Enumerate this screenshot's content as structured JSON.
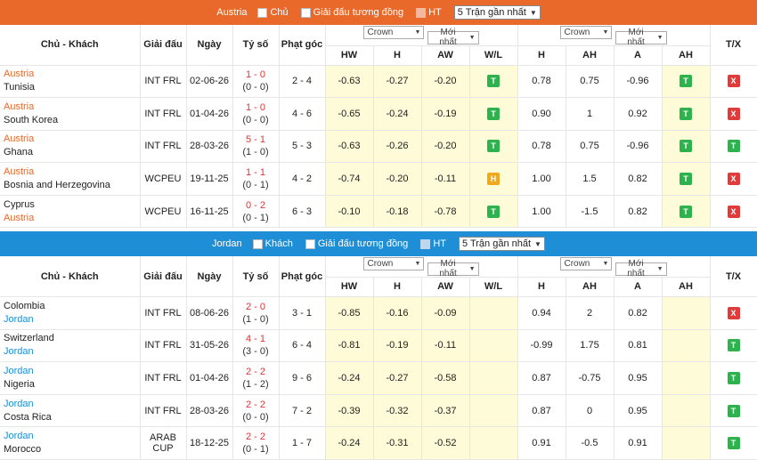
{
  "home_section": {
    "filter": {
      "team": "Austria",
      "home_label": "Chủ",
      "same_league_label": "Giải đấu tương đồng",
      "ht_label": "HT",
      "recent_select": "5 Trận gần nhất"
    },
    "header": {
      "teams": "Chủ - Khách",
      "league": "Giải đấu",
      "date": "Ngày",
      "score": "Tỷ số",
      "corners": "Phạt góc",
      "odds1_company": "Crown",
      "odds1_time": "Mới nhất",
      "odds2_company": "Crown",
      "odds2_time": "Mới nhất",
      "tx": "T/X",
      "hw": "HW",
      "h": "H",
      "aw": "AW",
      "wl": "W/L",
      "h2": "H",
      "ah": "AH",
      "a": "A",
      "ah2": "AH"
    },
    "rows": [
      {
        "home": "Austria",
        "away": "Tunisia",
        "home_color": "orange",
        "away_color": "dark",
        "league": "INT FRL",
        "date": "02-06-26",
        "score": "1 - 0",
        "ht": "(0 - 0)",
        "corners": "2 - 4",
        "hw": "-0.63",
        "h": "-0.27",
        "aw": "-0.20",
        "wl": "T",
        "h2": "0.78",
        "ah": "0.75",
        "a": "-0.96",
        "ah_res": "T",
        "tx": "X"
      },
      {
        "home": "Austria",
        "away": "South Korea",
        "home_color": "orange",
        "away_color": "dark",
        "league": "INT FRL",
        "date": "01-04-26",
        "score": "1 - 0",
        "ht": "(0 - 0)",
        "corners": "4 - 6",
        "hw": "-0.65",
        "h": "-0.24",
        "aw": "-0.19",
        "wl": "T",
        "h2": "0.90",
        "ah": "1",
        "a": "0.92",
        "ah_res": "T",
        "tx": "X"
      },
      {
        "home": "Austria",
        "away": "Ghana",
        "home_color": "orange",
        "away_color": "dark",
        "league": "INT FRL",
        "date": "28-03-26",
        "score": "5 - 1",
        "ht": "(1 - 0)",
        "corners": "5 - 3",
        "hw": "-0.63",
        "h": "-0.26",
        "aw": "-0.20",
        "wl": "T",
        "h2": "0.78",
        "ah": "0.75",
        "a": "-0.96",
        "ah_res": "T",
        "tx": "T"
      },
      {
        "home": "Austria",
        "away": "Bosnia and Herzegovina",
        "home_color": "orange",
        "away_color": "dark",
        "league": "WCPEU",
        "date": "19-11-25",
        "score": "1 - 1",
        "ht": "(0 - 1)",
        "corners": "4 - 2",
        "hw": "-0.74",
        "h": "-0.20",
        "aw": "-0.11",
        "wl": "H",
        "h2": "1.00",
        "ah": "1.5",
        "a": "0.82",
        "ah_res": "T",
        "tx": "X"
      },
      {
        "home": "Cyprus",
        "away": "Austria",
        "home_color": "dark",
        "away_color": "orange",
        "league": "WCPEU",
        "date": "16-11-25",
        "score": "0 - 2",
        "ht": "(0 - 1)",
        "corners": "6 - 3",
        "hw": "-0.10",
        "h": "-0.18",
        "aw": "-0.78",
        "wl": "T",
        "h2": "1.00",
        "ah": "-1.5",
        "a": "0.82",
        "ah_res": "T",
        "tx": "X"
      }
    ]
  },
  "away_section": {
    "filter": {
      "team": "Jordan",
      "away_label": "Khách",
      "same_league_label": "Giải đấu tương đồng",
      "ht_label": "HT",
      "recent_select": "5 Trận gần nhất"
    },
    "header": {
      "teams": "Chủ - Khách",
      "league": "Giải đấu",
      "date": "Ngày",
      "score": "Tỷ số",
      "corners": "Phạt góc",
      "odds1_company": "Crown",
      "odds1_time": "Mới nhất",
      "odds2_company": "Crown",
      "odds2_time": "Mới nhất",
      "tx": "T/X",
      "hw": "HW",
      "h": "H",
      "aw": "AW",
      "wl": "W/L",
      "h2": "H",
      "ah": "AH",
      "a": "A",
      "ah2": "AH"
    },
    "rows": [
      {
        "home": "Colombia",
        "away": "Jordan",
        "home_color": "dark",
        "away_color": "blue",
        "league": "INT FRL",
        "date": "08-06-26",
        "score": "2 - 0",
        "ht": "(1 - 0)",
        "corners": "3 - 1",
        "hw": "-0.85",
        "h": "-0.16",
        "aw": "-0.09",
        "wl": "",
        "h2": "0.94",
        "ah": "2",
        "a": "0.82",
        "ah_res": "",
        "tx": "X"
      },
      {
        "home": "Switzerland",
        "away": "Jordan",
        "home_color": "dark",
        "away_color": "blue",
        "league": "INT FRL",
        "date": "31-05-26",
        "score": "4 - 1",
        "ht": "(3 - 0)",
        "corners": "6 - 4",
        "hw": "-0.81",
        "h": "-0.19",
        "aw": "-0.11",
        "wl": "",
        "h2": "-0.99",
        "ah": "1.75",
        "a": "0.81",
        "ah_res": "",
        "tx": "T"
      },
      {
        "home": "Jordan",
        "away": "Nigeria",
        "home_color": "blue",
        "away_color": "dark",
        "league": "INT FRL",
        "date": "01-04-26",
        "score": "2 - 2",
        "ht": "(1 - 2)",
        "corners": "9 - 6",
        "hw": "-0.24",
        "h": "-0.27",
        "aw": "-0.58",
        "wl": "",
        "h2": "0.87",
        "ah": "-0.75",
        "a": "0.95",
        "ah_res": "",
        "tx": "T"
      },
      {
        "home": "Jordan",
        "away": "Costa Rica",
        "home_color": "blue",
        "away_color": "dark",
        "league": "INT FRL",
        "date": "28-03-26",
        "score": "2 - 2",
        "ht": "(0 - 0)",
        "corners": "7 - 2",
        "hw": "-0.39",
        "h": "-0.32",
        "aw": "-0.37",
        "wl": "",
        "h2": "0.87",
        "ah": "0",
        "a": "0.95",
        "ah_res": "",
        "tx": "T"
      },
      {
        "home": "Jordan",
        "away": "Morocco",
        "home_color": "blue",
        "away_color": "dark",
        "league": "ARAB CUP",
        "date": "18-12-25",
        "score": "2 - 2",
        "ht": "(0 - 1)",
        "corners": "1 - 7",
        "hw": "-0.24",
        "h": "-0.31",
        "aw": "-0.52",
        "wl": "",
        "h2": "0.91",
        "ah": "-0.5",
        "a": "0.91",
        "ah_res": "",
        "tx": "T"
      }
    ]
  },
  "colors": {
    "home_accent": "#e8692a",
    "away_accent": "#1e8fd6",
    "win": "#2db24d",
    "loss": "#e03b3b",
    "draw": "#f0a81c",
    "highlight": "#fefbd8"
  }
}
